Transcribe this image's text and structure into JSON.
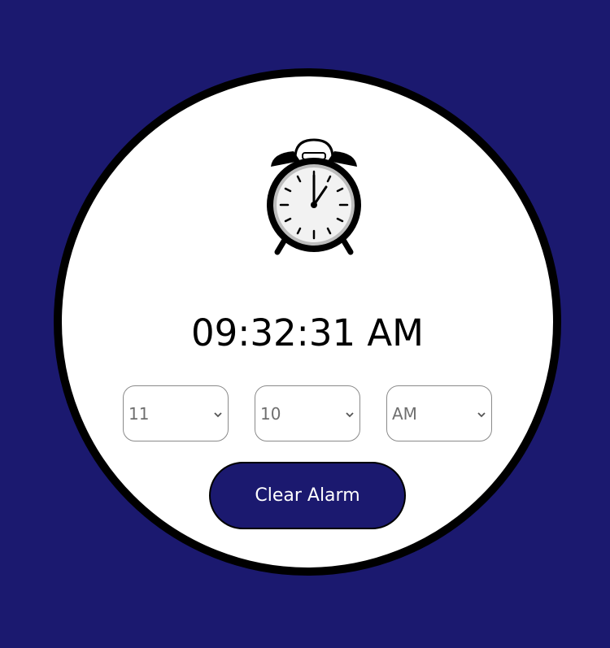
{
  "clock": {
    "current_time": "09:32:31 AM",
    "icon": "alarm-clock-icon"
  },
  "alarm": {
    "hour": {
      "selected": "11"
    },
    "minute": {
      "selected": "10"
    },
    "ampm": {
      "selected": "AM"
    },
    "clear_button_label": "Clear Alarm"
  },
  "colors": {
    "background": "#1b196f",
    "card": "#ffffff",
    "card_border": "#000000",
    "button": "#1b196f",
    "button_text": "#ffffff"
  }
}
